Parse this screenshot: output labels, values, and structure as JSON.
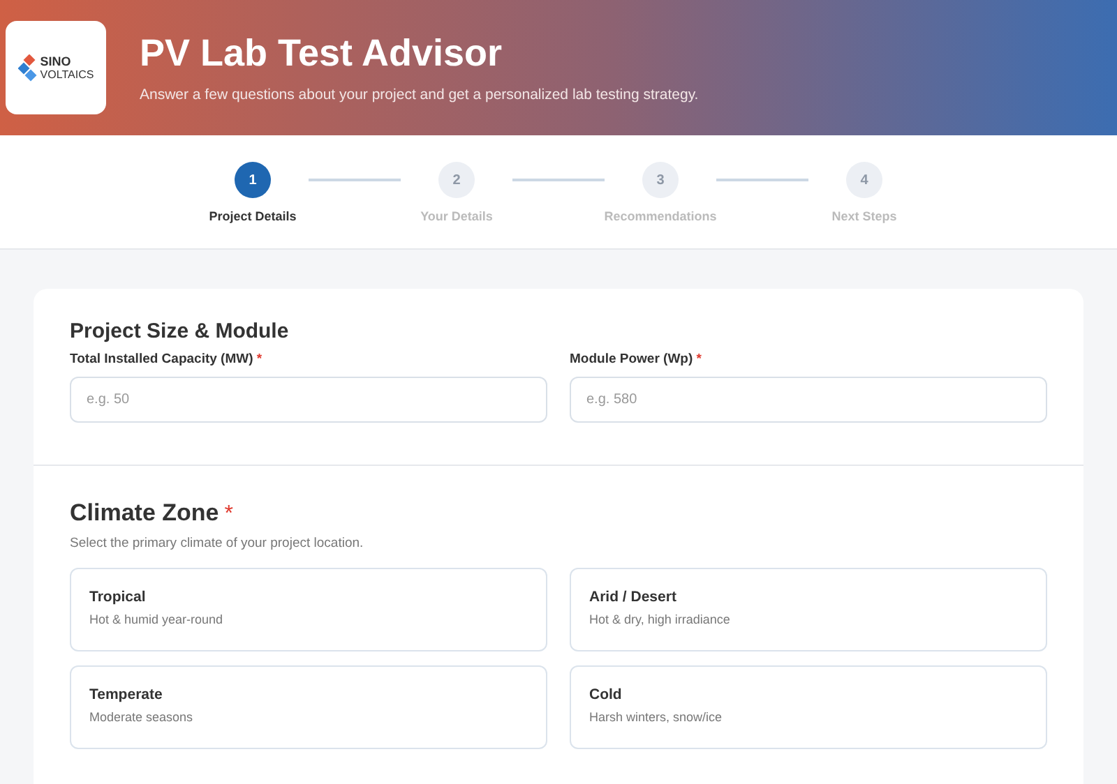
{
  "header": {
    "logo": {
      "line_1": "SINO",
      "line_2": "VOLTAICS"
    },
    "title": "PV Lab Test Advisor",
    "subtitle": "Answer a few questions about your project and get a personalized lab testing strategy."
  },
  "steps": [
    {
      "number": "1",
      "label": "Project Details",
      "selected": true
    },
    {
      "number": "2",
      "label": "Your Details",
      "selected": false
    },
    {
      "number": "3",
      "label": "Recommendations",
      "selected": false
    },
    {
      "number": "4",
      "label": "Next Steps",
      "selected": false
    }
  ],
  "project_size": {
    "heading": "Project Size & Module",
    "fields": [
      {
        "label": "Total Installed Capacity (MW)",
        "required_mark": "*",
        "placeholder": "e.g. 50"
      },
      {
        "label": "Module Power (Wp)",
        "required_mark": "*",
        "placeholder": "e.g. 580"
      }
    ]
  },
  "climate_zone": {
    "heading": "Climate Zone",
    "required_mark": "*",
    "description": "Select the primary climate of your project location.",
    "options": [
      {
        "title": "Tropical",
        "description": "Hot & humid year-round",
        "selected": false
      },
      {
        "title": "Arid / Desert",
        "description": "Hot & dry, high irradiance",
        "selected": false
      },
      {
        "title": "Temperate",
        "description": "Moderate seasons",
        "selected": false
      },
      {
        "title": "Cold",
        "description": "Harsh winters, snow/ice",
        "selected": false
      }
    ]
  }
}
